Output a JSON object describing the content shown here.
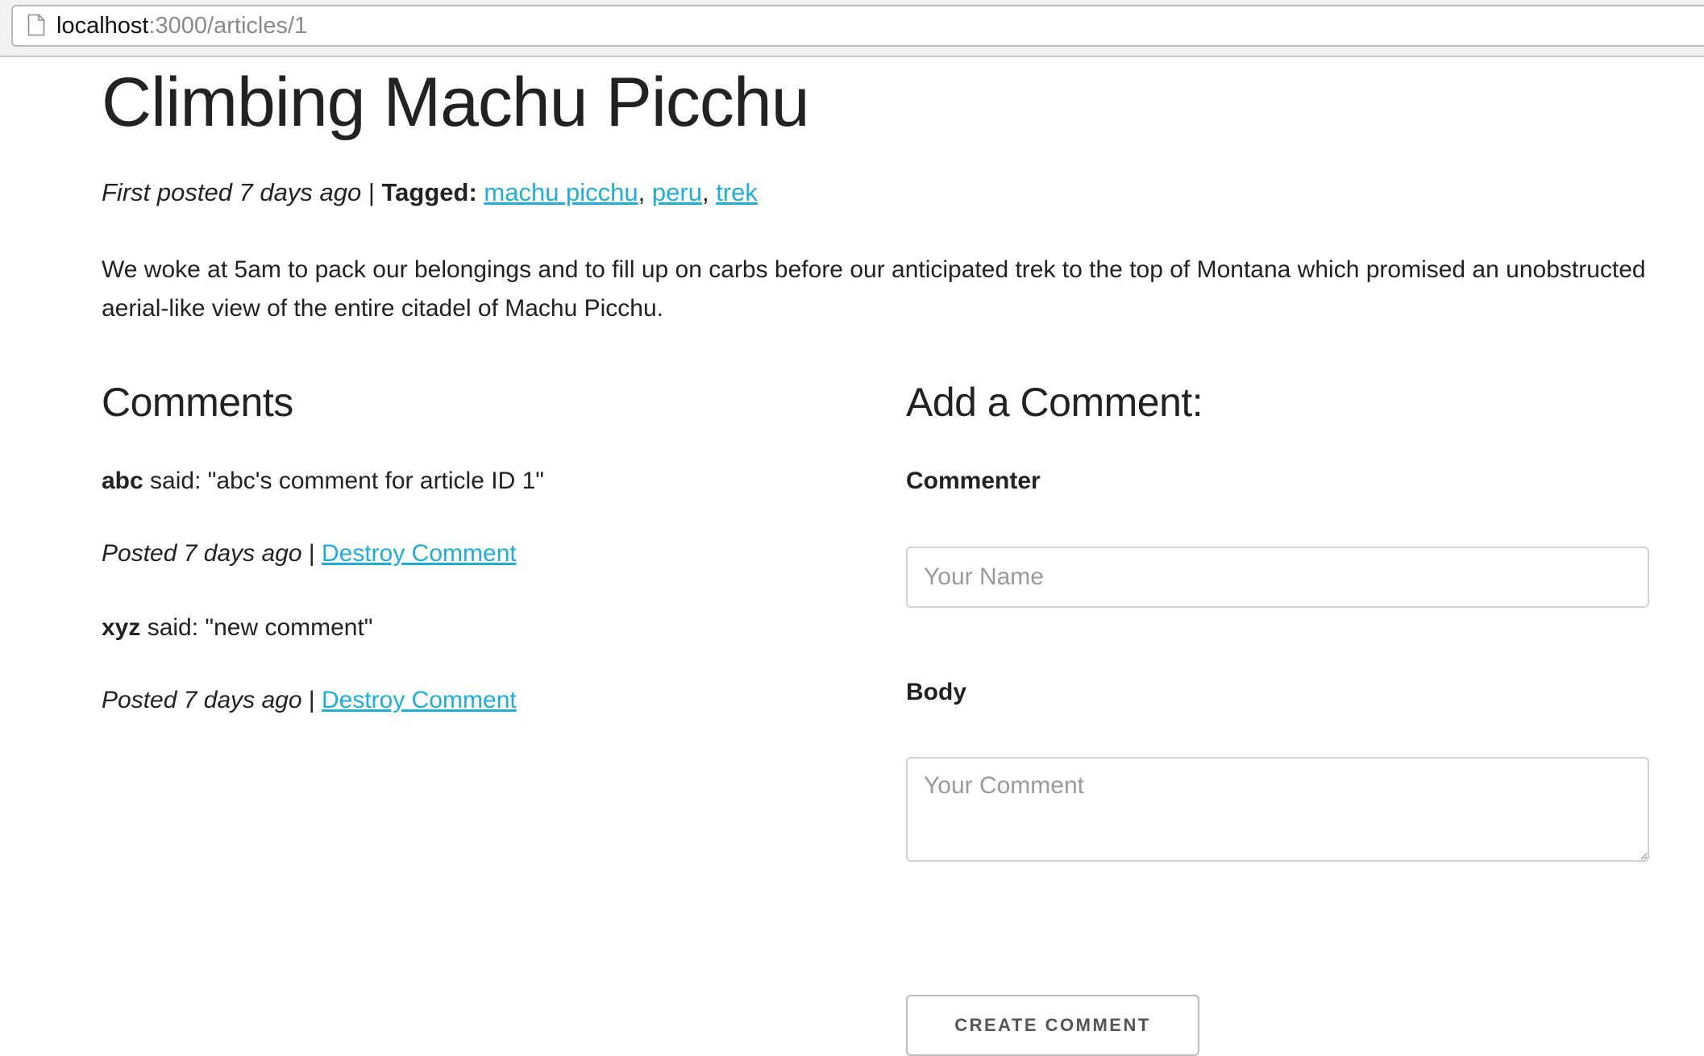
{
  "browser": {
    "url_host": "localhost",
    "url_rest": ":3000/articles/1",
    "page_icon": "page-icon"
  },
  "article": {
    "title": "Climbing Machu Picchu",
    "posted": "First posted 7 days ago",
    "separator": " | ",
    "tagged_label": "Tagged:",
    "tags": [
      "machu picchu",
      "peru",
      "trek"
    ],
    "tag_separator": ", ",
    "body": "We woke at 5am to pack our belongings and to fill up on carbs before our anticipated trek to the top of Montana which promised an unobstructed aerial-like view of the entire citadel of Machu Picchu."
  },
  "comments": {
    "heading": "Comments",
    "said_label": " said: ",
    "items": [
      {
        "commenter": "abc",
        "body": "\"abc's comment for article ID 1\"",
        "posted": "Posted 7 days ago",
        "separator": " | ",
        "destroy_label": "Destroy Comment"
      },
      {
        "commenter": "xyz",
        "body": "\"new comment\"",
        "posted": "Posted 7 days ago",
        "separator": " | ",
        "destroy_label": "Destroy Comment"
      }
    ]
  },
  "form": {
    "heading": "Add a Comment:",
    "commenter_label": "Commenter",
    "commenter_value": "",
    "commenter_placeholder": "Your Name",
    "body_label": "Body",
    "body_value": "",
    "body_placeholder": "Your Comment",
    "submit_label": "Create Comment"
  },
  "colors": {
    "link": "#1eaedb",
    "text": "#222222",
    "placeholder": "#9a9a9a",
    "input_border": "#d1d1d1"
  }
}
